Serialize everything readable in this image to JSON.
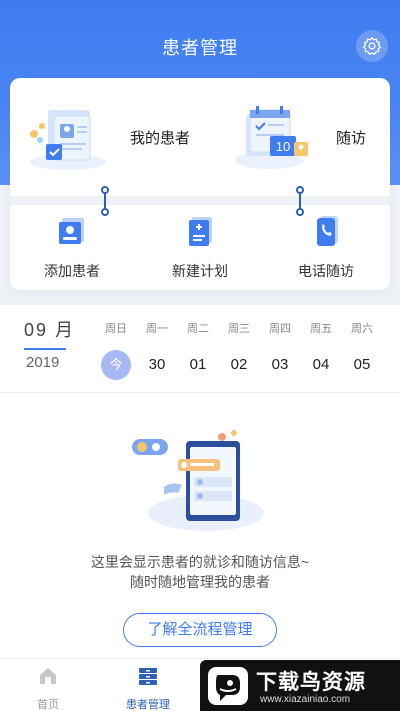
{
  "header": {
    "title": "患者管理",
    "settings_icon": "gear-icon",
    "accent": "#3f7cf0"
  },
  "card": {
    "top_items": [
      {
        "label": "我的患者",
        "icon": "patient-folder-icon"
      },
      {
        "label": "随访",
        "icon": "calendar-icon",
        "badge": "10"
      }
    ],
    "quick_actions": [
      {
        "label": "添加患者",
        "icon": "add-patient-icon"
      },
      {
        "label": "新建计划",
        "icon": "new-plan-icon"
      },
      {
        "label": "电话随访",
        "icon": "phone-icon"
      }
    ]
  },
  "calendar": {
    "month": "09 月",
    "year": "2019",
    "days": [
      {
        "weekday": "周日",
        "date": "今",
        "today": true
      },
      {
        "weekday": "周一",
        "date": "30"
      },
      {
        "weekday": "周二",
        "date": "01"
      },
      {
        "weekday": "周三",
        "date": "02"
      },
      {
        "weekday": "周四",
        "date": "03"
      },
      {
        "weekday": "周五",
        "date": "04"
      },
      {
        "weekday": "周六",
        "date": "05"
      }
    ]
  },
  "empty_state": {
    "line1": "这里会显示患者的就诊和随访信息~",
    "line2": "随时随地管理我的患者",
    "button": "了解全流程管理"
  },
  "tabbar": {
    "tabs": [
      {
        "label": "首页",
        "icon": "home-icon"
      },
      {
        "label": "患者管理",
        "icon": "patients-icon",
        "active": true
      }
    ]
  },
  "watermark": {
    "title": "下载鸟资源",
    "url": "www.xiazainiao.com"
  }
}
